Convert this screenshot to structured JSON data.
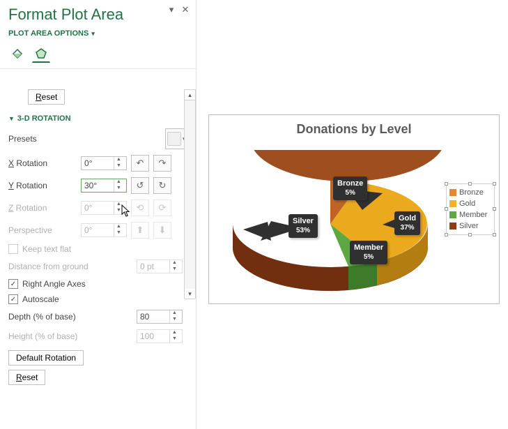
{
  "panel": {
    "title": "Format Plot Area",
    "subhead": "PLOT AREA OPTIONS",
    "reset": "Reset",
    "default_rotation": "Default Rotation",
    "section": "3-D ROTATION",
    "presets_label": "Presets",
    "x_rotation": {
      "label": "X Rotation",
      "value": "0°"
    },
    "y_rotation": {
      "label": "Y Rotation",
      "value": "30°"
    },
    "z_rotation": {
      "label": "Z Rotation",
      "value": "0°"
    },
    "perspective": {
      "label": "Perspective",
      "value": "0°"
    },
    "keep_text_flat": "Keep text flat",
    "distance_from_ground": {
      "label": "Distance from ground",
      "value": "0 pt"
    },
    "right_angle_axes": "Right Angle Axes",
    "autoscale": "Autoscale",
    "depth": {
      "label": "Depth (% of base)",
      "value": "80"
    },
    "height": {
      "label": "Height (% of base)",
      "value": "100"
    }
  },
  "chart_data": {
    "type": "pie",
    "title": "Donations by Level",
    "series": [
      {
        "name": "Bronze",
        "value": 5,
        "color": "#ae5a21"
      },
      {
        "name": "Gold",
        "value": 37,
        "color": "#f0b429"
      },
      {
        "name": "Member",
        "value": 5,
        "color": "#5ea843"
      },
      {
        "name": "Silver",
        "value": 53,
        "color": "#b45a24"
      }
    ],
    "labels": {
      "bronze": {
        "name": "Bronze",
        "pct": "5%"
      },
      "gold": {
        "name": "Gold",
        "pct": "37%"
      },
      "member": {
        "name": "Member",
        "pct": "5%"
      },
      "silver": {
        "name": "Silver",
        "pct": "53%"
      }
    },
    "legend": [
      "Bronze",
      "Gold",
      "Member",
      "Silver"
    ],
    "legend_colors": [
      "#e8872d",
      "#f0b429",
      "#5ea843",
      "#8a3f16"
    ]
  }
}
